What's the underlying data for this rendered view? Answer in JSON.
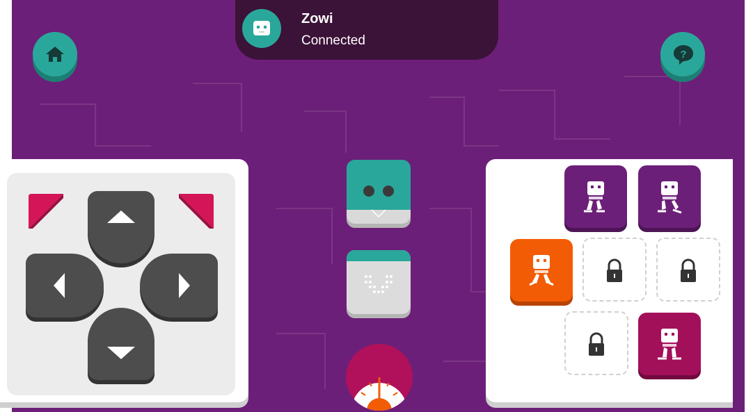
{
  "header": {
    "robot_name": "Zowi",
    "connection_status": "Connected"
  },
  "colors": {
    "background": "#6c1f78",
    "accent": "#2aa79b",
    "orange": "#f25c05",
    "magenta": "#a3105a",
    "dark_button": "#4d4d4d",
    "pink": "#d41558"
  },
  "icons": {
    "home": "home-icon",
    "help": "speech-bubble-question-icon",
    "robot_avatar": "robot-face-icon",
    "lock": "lock-icon"
  },
  "dpad": [
    "up",
    "left",
    "right",
    "down",
    "turn-left",
    "turn-right"
  ],
  "movement_tiles": [
    {
      "id": "walk-1",
      "state": "available",
      "color": "purple"
    },
    {
      "id": "walk-2",
      "state": "available",
      "color": "purple"
    },
    {
      "id": "dance",
      "state": "selected",
      "color": "orange"
    },
    {
      "id": "locked-1",
      "state": "locked"
    },
    {
      "id": "locked-2",
      "state": "locked"
    },
    {
      "id": "locked-3",
      "state": "locked"
    },
    {
      "id": "step",
      "state": "available",
      "color": "magenta"
    }
  ]
}
